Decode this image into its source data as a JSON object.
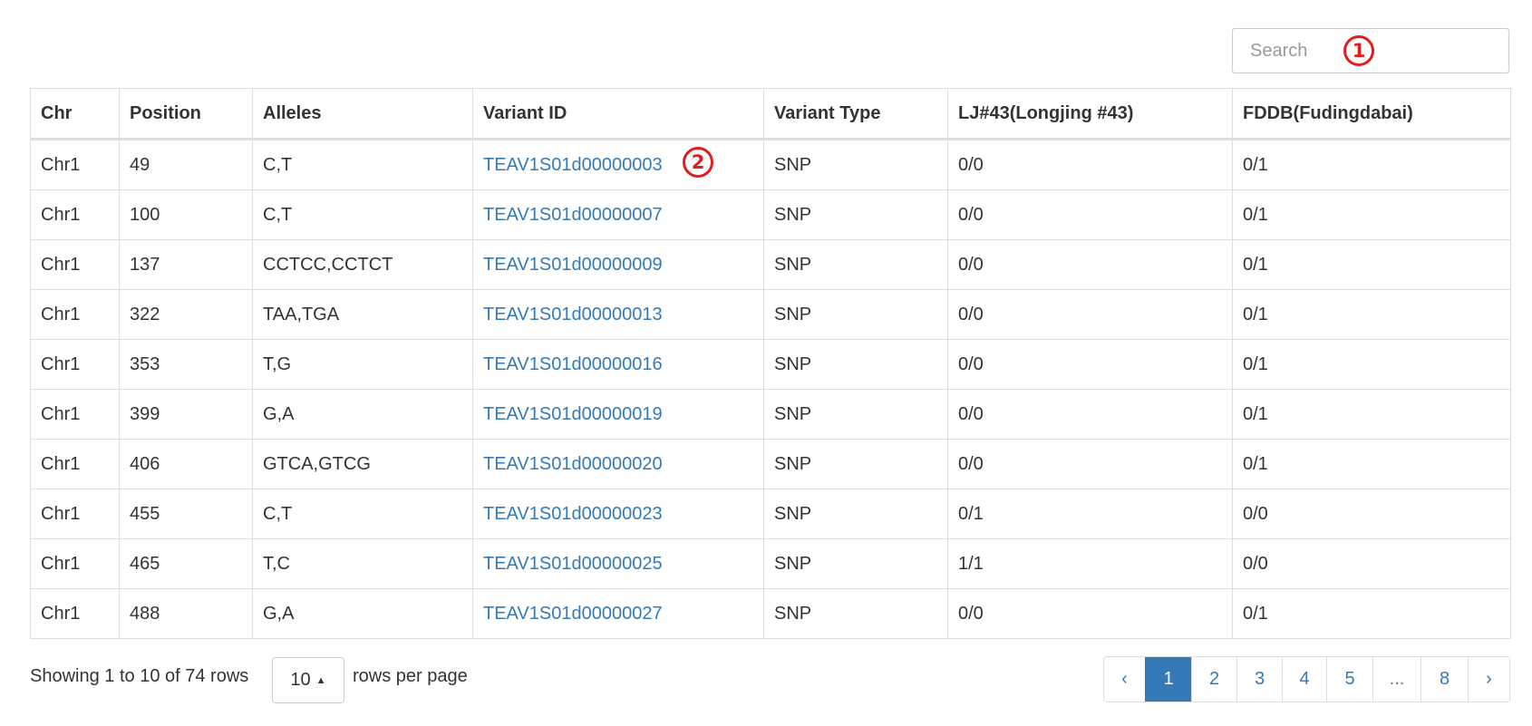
{
  "search": {
    "placeholder": "Search"
  },
  "markers": {
    "one": "1",
    "two": "2"
  },
  "table": {
    "headers": [
      "Chr",
      "Position",
      "Alleles",
      "Variant ID",
      "Variant Type",
      "LJ#43(Longjing #43)",
      "FDDB(Fudingdabai)"
    ],
    "rows": [
      [
        "Chr1",
        "49",
        "C,T",
        "TEAV1S01d00000003",
        "SNP",
        "0/0",
        "0/1"
      ],
      [
        "Chr1",
        "100",
        "C,T",
        "TEAV1S01d00000007",
        "SNP",
        "0/0",
        "0/1"
      ],
      [
        "Chr1",
        "137",
        "CCTCC,CCTCT",
        "TEAV1S01d00000009",
        "SNP",
        "0/0",
        "0/1"
      ],
      [
        "Chr1",
        "322",
        "TAA,TGA",
        "TEAV1S01d00000013",
        "SNP",
        "0/0",
        "0/1"
      ],
      [
        "Chr1",
        "353",
        "T,G",
        "TEAV1S01d00000016",
        "SNP",
        "0/0",
        "0/1"
      ],
      [
        "Chr1",
        "399",
        "G,A",
        "TEAV1S01d00000019",
        "SNP",
        "0/0",
        "0/1"
      ],
      [
        "Chr1",
        "406",
        "GTCA,GTCG",
        "TEAV1S01d00000020",
        "SNP",
        "0/0",
        "0/1"
      ],
      [
        "Chr1",
        "455",
        "C,T",
        "TEAV1S01d00000023",
        "SNP",
        "0/1",
        "0/0"
      ],
      [
        "Chr1",
        "465",
        "T,C",
        "TEAV1S01d00000025",
        "SNP",
        "1/1",
        "0/0"
      ],
      [
        "Chr1",
        "488",
        "G,A",
        "TEAV1S01d00000027",
        "SNP",
        "0/0",
        "0/1"
      ]
    ]
  },
  "footer": {
    "showing": "Showing 1 to 10 of 74 rows",
    "page_size": "10",
    "rows_per_page": "rows per page"
  },
  "pagination": {
    "prev": "‹",
    "pages": [
      "1",
      "2",
      "3",
      "4",
      "5"
    ],
    "ellipsis": "...",
    "last": "8",
    "next": "›",
    "active": "1"
  },
  "colors": {
    "link": "#337ab7",
    "marker": "#e11d1d",
    "border": "#dddddd"
  }
}
